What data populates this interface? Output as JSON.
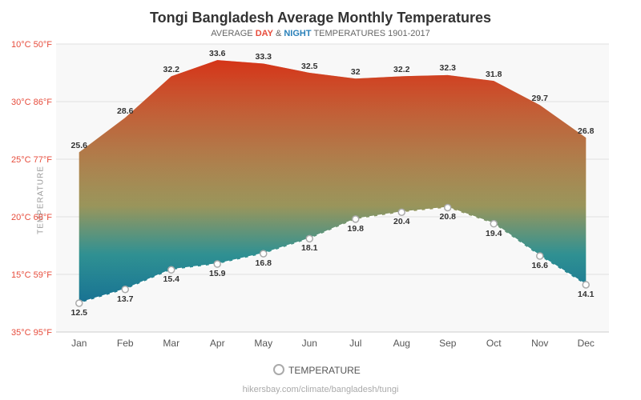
{
  "title": "Tongi Bangladesh Average Monthly Temperatures",
  "subtitle": {
    "prefix": "AVERAGE ",
    "day": "DAY",
    "middle": " & ",
    "night": "NIGHT",
    "suffix": " TEMPERATURES 1901-2017"
  },
  "y_axis_label": "TEMPERATURE",
  "months": [
    "Jan",
    "Feb",
    "Mar",
    "Apr",
    "May",
    "Jun",
    "Jul",
    "Aug",
    "Sep",
    "Oct",
    "Nov",
    "Dec"
  ],
  "day_temps": [
    25.6,
    28.6,
    32.2,
    33.6,
    33.3,
    32.5,
    32.0,
    32.2,
    32.3,
    31.8,
    29.7,
    26.8
  ],
  "night_temps": [
    12.5,
    13.7,
    15.4,
    15.9,
    16.8,
    18.1,
    19.8,
    20.4,
    20.8,
    19.4,
    16.6,
    14.1
  ],
  "y_labels": [
    "10°C 50°F",
    "15°C 59°F",
    "20°C 68°F",
    "25°C 77°F",
    "30°C 86°F",
    "35°C 95°F"
  ],
  "y_values": [
    10,
    15,
    20,
    25,
    30,
    35
  ],
  "footer": "hikersbay.com/climate/bangladesh/tungi",
  "legend_label": "TEMPERATURE",
  "colors": {
    "title": "#333333",
    "day_accent": "#e74c3c",
    "night_accent": "#2980b9",
    "grid": "#e0e0e0",
    "axis_text": "#999999"
  }
}
